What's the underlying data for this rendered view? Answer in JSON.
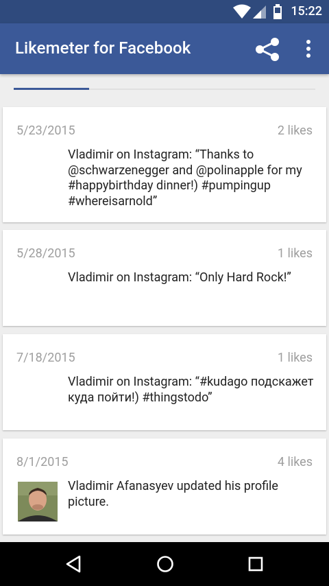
{
  "status_bar": {
    "time": "15:22"
  },
  "app_bar": {
    "title": "Likemeter for Facebook"
  },
  "cards": [
    {
      "date": "5/23/2015",
      "likes": "2 likes",
      "text": "Vladimir on Instagram: “Thanks to @schwarzenegger and @polinapple for my #happybirthday dinner!) #pumpingup #whereisarnold”"
    },
    {
      "date": "5/28/2015",
      "likes": "1 likes",
      "text": "Vladimir on Instagram: “Only Hard Rock!”"
    },
    {
      "date": "7/18/2015",
      "likes": "1 likes",
      "text": "Vladimir on Instagram: “#kudago подскажет куда пойти!) #thingstodo”"
    },
    {
      "date": "8/1/2015",
      "likes": "4 likes",
      "text": "Vladimir Afanasyev updated his profile picture."
    }
  ],
  "icons": {
    "share": "share-icon",
    "more": "more-vert-icon",
    "back": "back-triangle-icon",
    "home": "home-circle-icon",
    "recents": "recents-square-icon"
  }
}
